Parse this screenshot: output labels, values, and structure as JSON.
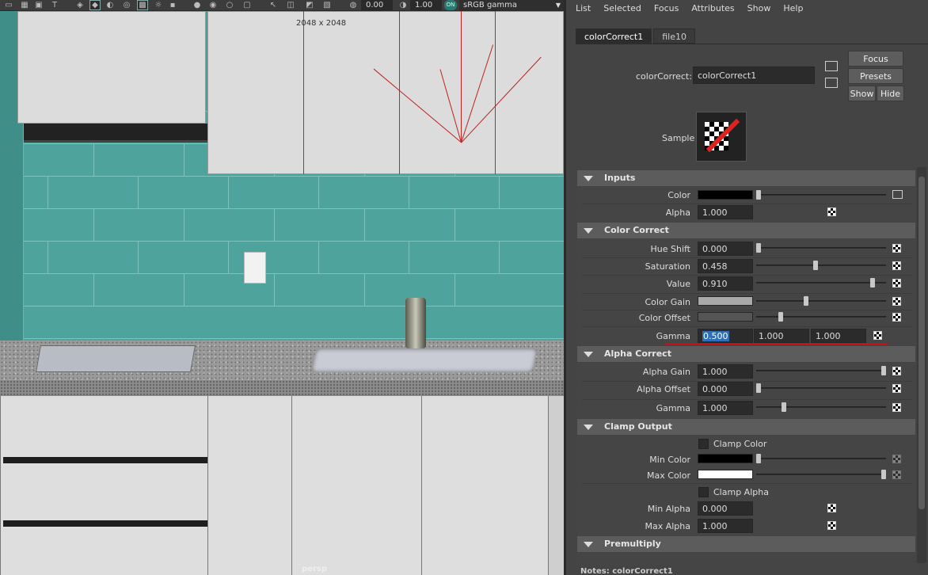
{
  "viewport": {
    "toolbar": {
      "exposure": "0.00",
      "gamma": "1.00",
      "colorspace": "sRGB gamma",
      "on_badge": "ON"
    },
    "resolution": "2048 x 2048",
    "camera": "persp"
  },
  "editor": {
    "menu": [
      "List",
      "Selected",
      "Focus",
      "Attributes",
      "Show",
      "Help"
    ],
    "tabs": [
      "colorCorrect1",
      "file10"
    ],
    "node_label": "colorCorrect:",
    "node_name": "colorCorrect1",
    "buttons": {
      "focus": "Focus",
      "presets": "Presets",
      "show": "Show",
      "hide": "Hide"
    },
    "sample_label": "Sample",
    "sections": {
      "inputs": {
        "title": "Inputs",
        "color_label": "Color",
        "alpha_label": "Alpha",
        "alpha_value": "1.000"
      },
      "color_correct": {
        "title": "Color Correct",
        "hue_shift_label": "Hue Shift",
        "hue_shift_value": "0.000",
        "hue_shift_level": 0.0,
        "saturation_label": "Saturation",
        "saturation_value": "0.458",
        "saturation_level": 0.458,
        "value_label": "Value",
        "value_value": "0.910",
        "value_level": 0.91,
        "color_gain_label": "Color Gain",
        "color_gain_level": 0.38,
        "color_offset_label": "Color Offset",
        "color_offset_level": 0.18,
        "gamma_label": "Gamma",
        "gamma_values": [
          "0.500",
          "1.000",
          "1.000"
        ]
      },
      "alpha_correct": {
        "title": "Alpha Correct",
        "alpha_gain_label": "Alpha Gain",
        "alpha_gain_value": "1.000",
        "alpha_gain_level": 1.0,
        "alpha_offset_label": "Alpha Offset",
        "alpha_offset_value": "0.000",
        "alpha_offset_level": 0.0,
        "gamma_label": "Gamma",
        "gamma_value": "1.000",
        "gamma_level": 0.2
      },
      "clamp_output": {
        "title": "Clamp Output",
        "clamp_color_label": "Clamp Color",
        "min_color_label": "Min Color",
        "max_color_label": "Max Color",
        "clamp_alpha_label": "Clamp Alpha",
        "min_alpha_label": "Min Alpha",
        "min_alpha_value": "0.000",
        "max_alpha_label": "Max Alpha",
        "max_alpha_value": "1.000"
      },
      "premultiply": {
        "title": "Premultiply"
      }
    },
    "notes": "Notes: colorCorrect1",
    "colors": {
      "input_color": "#000000",
      "color_gain": "#a9a9a9",
      "color_offset": "#555555",
      "min_color": "#000000",
      "max_color": "#ffffff",
      "highlight": "#c4121d"
    }
  }
}
